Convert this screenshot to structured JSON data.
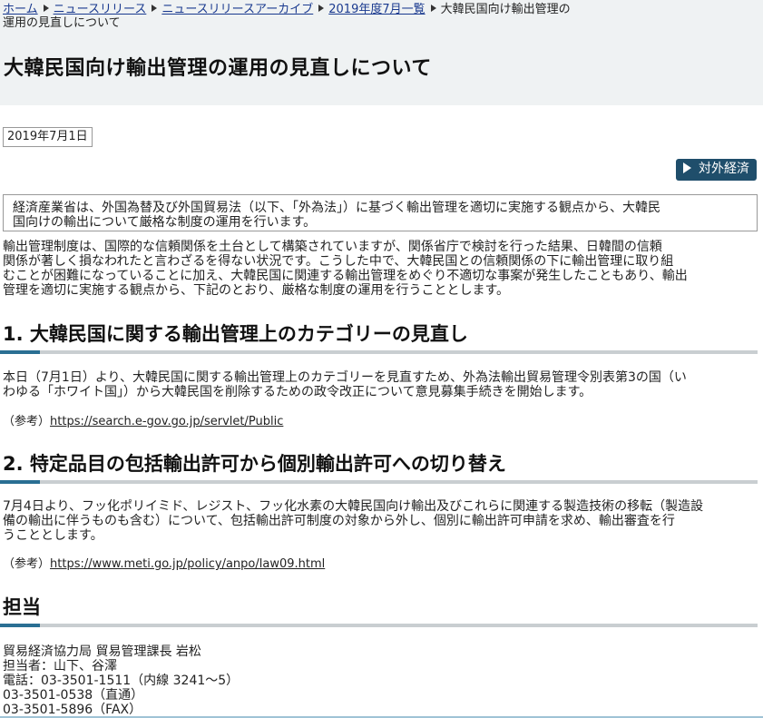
{
  "breadcrumb": {
    "home": "ホーム",
    "news": "ニュースリリース",
    "archive": "ニュースリリースアーカイブ",
    "month": "2019年度7月一覧",
    "current_line1": "大韓民国向け輸出管理の",
    "current_line2": "運用の見直しについて"
  },
  "page_title": "大韓民国向け輸出管理の運用の見直しについて",
  "date": "2019年7月1日",
  "category_button": "対外経済",
  "summary": {
    "line1": "経済産業省は、外国為替及び外国貿易法（以下、「外為法」）に基づく輸出管理を適切に実施する観点から、大韓民",
    "line2": "国向けの輸出について厳格な制度の運用を行います。"
  },
  "intro": {
    "line1": "輸出管理制度は、国際的な信頼関係を土台として構築されていますが、関係省庁で検討を行った結果、日韓間の信頼",
    "line2": "関係が著しく損なわれたと言わざるを得ない状況です。こうした中で、大韓民国との信頼関係の下に輸出管理に取り組",
    "line3": "むことが困難になっていることに加え、大韓民国に関連する輸出管理をめぐり不適切な事案が発生したこともあり、輸出",
    "line4": "管理を適切に実施する観点から、下記のとおり、厳格な制度の運用を行うこととします。"
  },
  "section1": {
    "heading": "1. 大韓民国に関する輸出管理上のカテゴリーの見直し",
    "line1": "本日（7月1日）より、大韓民国に関する輸出管理上のカテゴリーを見直すため、外為法輸出貿易管理令別表第3の国（い",
    "line2": "わゆる「ホワイト国」）から大韓民国を削除するための政令改正について意見募集手続きを開始します。",
    "ref_label": "（参考）",
    "ref_link": "https://search.e-gov.go.jp/servlet/Public"
  },
  "section2": {
    "heading": "2. 特定品目の包括輸出許可から個別輸出許可への切り替え",
    "line1": "7月4日より、フッ化ポリイミド、レジスト、フッ化水素の大韓民国向け輸出及びこれらに関連する製造技術の移転（製造設",
    "line2": "備の輸出に伴うものも含む）について、包括輸出許可制度の対象から外し、個別に輸出許可申請を求め、輸出審査を行",
    "line3": "うこととします。",
    "ref_label": "（参考）",
    "ref_link": "https://www.meti.go.jp/policy/anpo/law09.html"
  },
  "contact": {
    "heading": "担当",
    "line1": "貿易経済協力局 貿易管理課長 岩松",
    "line2": "担当者：山下、谷澤",
    "line3": "電話：03-3501-1511（内線 3241～5）",
    "line4": "03-3501-0538（直通）",
    "line5": "03-3501-5896（FAX）"
  }
}
